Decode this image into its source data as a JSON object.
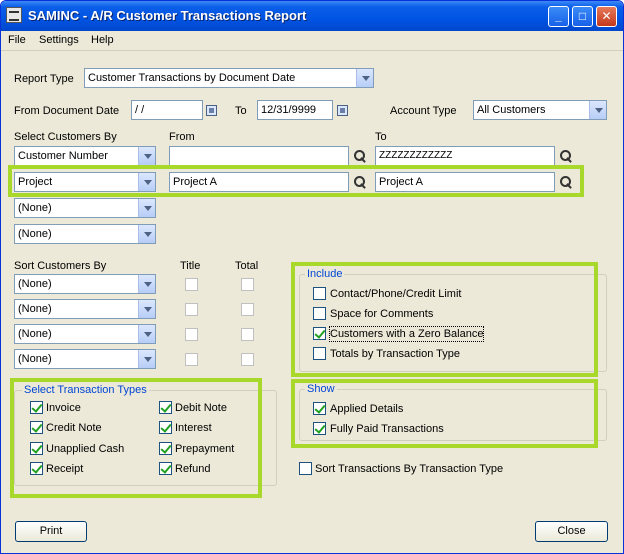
{
  "window": {
    "title": "SAMINC - A/R Customer Transactions Report",
    "minimize": "_",
    "maximize": "□",
    "close": "✕"
  },
  "menu": [
    "File",
    "Settings",
    "Help"
  ],
  "report": {
    "type_label": "Report Type",
    "type_value": "Customer Transactions by Document Date",
    "from_date_label": "From Document Date",
    "from_date_value": " / /",
    "to_label": "To",
    "to_date_value": "12/31/9999",
    "account_type_label": "Account Type",
    "account_type_value": "All Customers"
  },
  "select_customers": {
    "label": "Select Customers By",
    "from_header": "From",
    "to_header": "To",
    "rows": [
      {
        "criteria": "Customer Number",
        "from": "",
        "to": "ZZZZZZZZZZZZ"
      },
      {
        "criteria": "Project",
        "from": "Project A",
        "to": "Project A"
      },
      {
        "criteria": "(None)"
      },
      {
        "criteria": "(None)"
      }
    ]
  },
  "sort_customers": {
    "label": "Sort Customers By",
    "title_header": "Title",
    "total_header": "Total",
    "rows": [
      "(None)",
      "(None)",
      "(None)",
      "(None)"
    ]
  },
  "include": {
    "title": "Include",
    "options": [
      {
        "label": "Contact/Phone/Credit Limit",
        "checked": false
      },
      {
        "label": "Space for Comments",
        "checked": false
      },
      {
        "label": "Customers with a Zero Balance",
        "checked": true
      },
      {
        "label": "Totals by Transaction Type",
        "checked": false
      }
    ]
  },
  "show": {
    "title": "Show",
    "options": [
      {
        "label": "Applied Details",
        "checked": true
      },
      {
        "label": "Fully Paid Transactions",
        "checked": true
      }
    ]
  },
  "transaction_types": {
    "title": "Select Transaction Types",
    "left": [
      "Invoice",
      "Credit Note",
      "Unapplied Cash",
      "Receipt"
    ],
    "right": [
      "Debit Note",
      "Interest",
      "Prepayment",
      "Refund"
    ]
  },
  "sort_by_transaction_type": "Sort Transactions By Transaction Type",
  "buttons": {
    "print": "Print",
    "close": "Close"
  },
  "colors": {
    "highlight": "#a8d82a",
    "group_title": "#0046d5",
    "titlebar": "#0054e3"
  }
}
